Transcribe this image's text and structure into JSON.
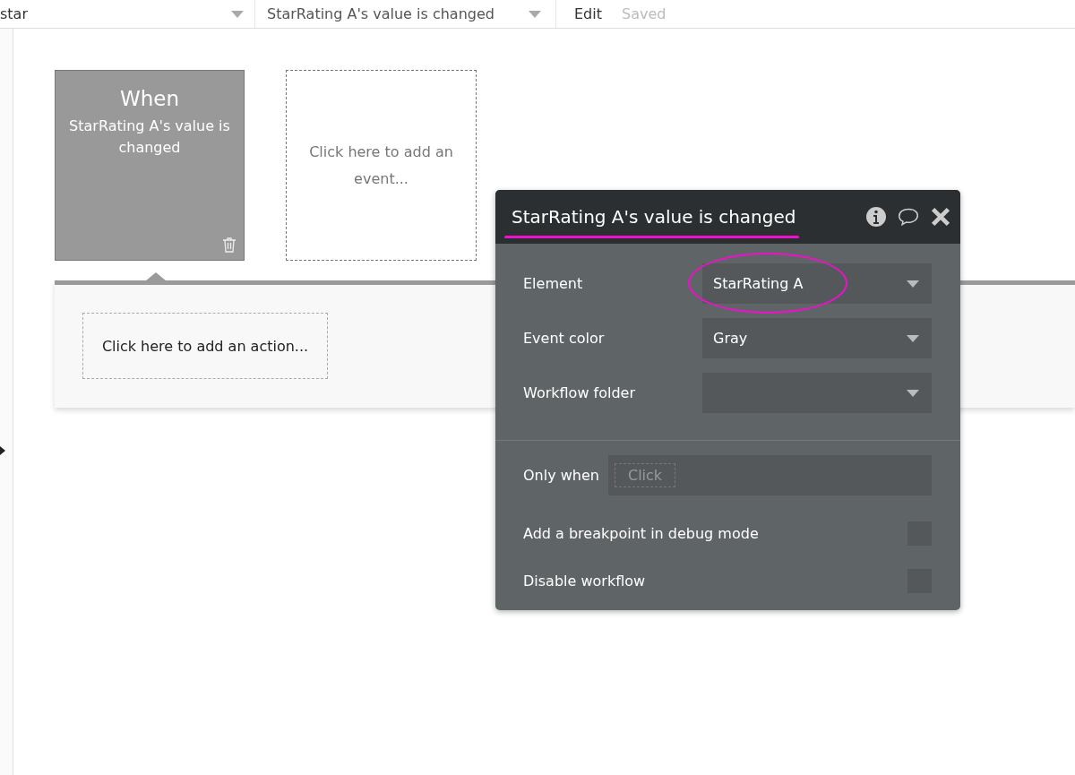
{
  "toolbar": {
    "page_dropdown": "star",
    "event_dropdown": "StarRating A's value is changed",
    "edit_link": "Edit",
    "save_status": "Saved"
  },
  "event_card": {
    "heading": "When",
    "description": "StarRating A's value is changed"
  },
  "add_event": {
    "text": "Click here to add an event..."
  },
  "action_panel": {
    "add_action": "Click here to add an action..."
  },
  "popup": {
    "title": "StarRating A's value is changed",
    "fields": [
      {
        "label": "Element",
        "value": "StarRating A",
        "highlighted": true
      },
      {
        "label": "Event color",
        "value": "Gray",
        "highlighted": false
      },
      {
        "label": "Workflow folder",
        "highlighted": false
      }
    ],
    "only_when": {
      "label": "Only when",
      "placeholder": "Click"
    },
    "options": [
      {
        "label": "Add a breakpoint in debug mode",
        "checked": false
      },
      {
        "label": "Disable workflow",
        "checked": false
      }
    ]
  }
}
